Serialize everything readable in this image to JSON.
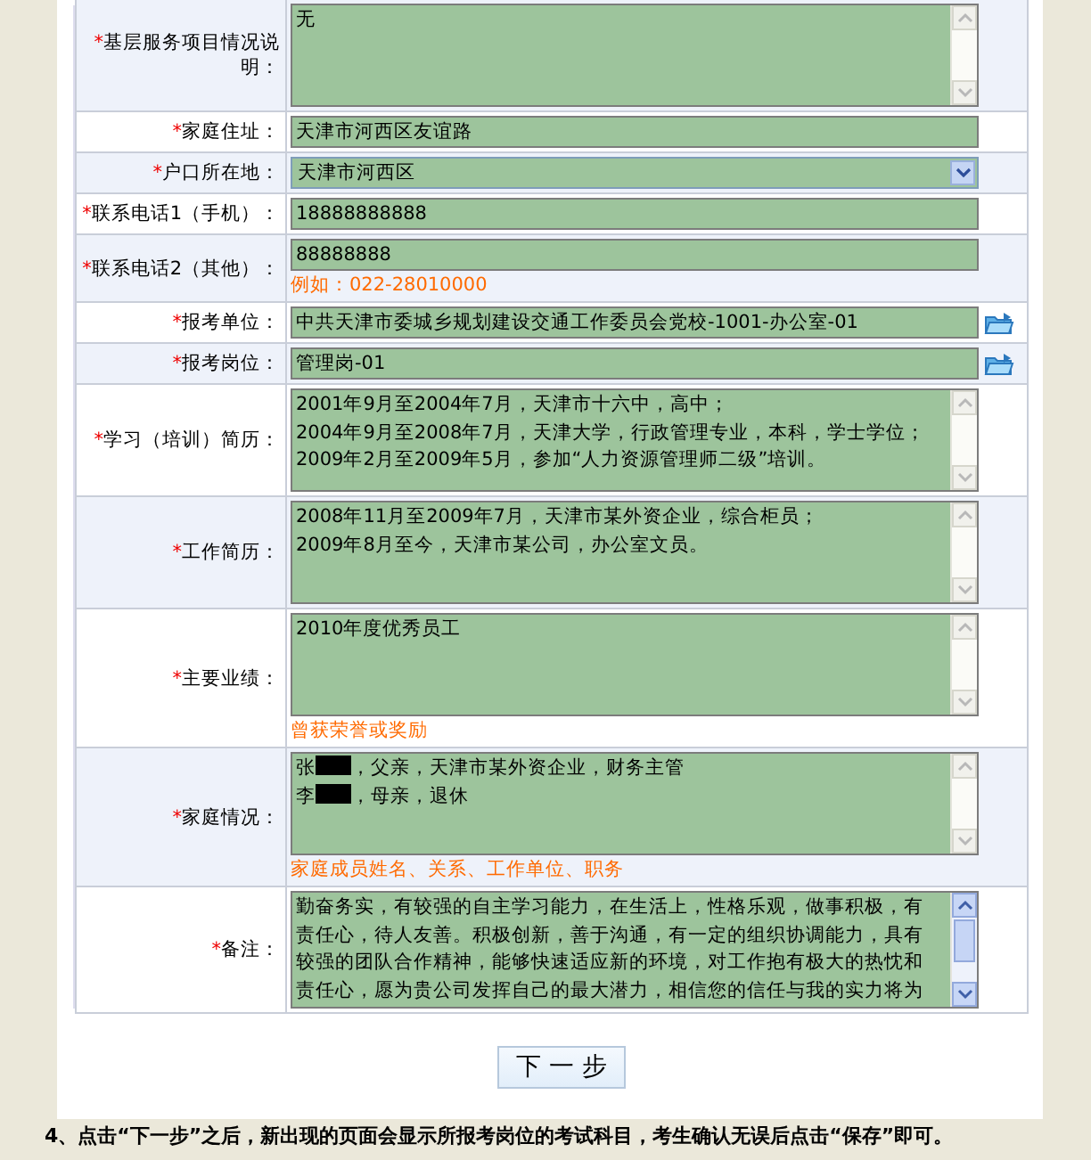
{
  "required_mark": "*",
  "rows": [
    {
      "kind": "textarea",
      "label": "基层服务项目情况说明：",
      "required": true,
      "lines": [
        "无"
      ],
      "scroll_enabled": false
    },
    {
      "kind": "input",
      "label": "家庭住址：",
      "required": true,
      "value": "天津市河西区友谊路"
    },
    {
      "kind": "select",
      "label": "户口所在地：",
      "required": true,
      "value": "天津市河西区"
    },
    {
      "kind": "input",
      "label": "联系电话1（手机）：",
      "required": true,
      "value": "18888888888"
    },
    {
      "kind": "input",
      "label": "联系电话2（其他）：",
      "required": true,
      "value": "88888888",
      "hint": "例如：022-28010000"
    },
    {
      "kind": "input",
      "label": "报考单位：",
      "required": true,
      "value": "中共天津市委城乡规划建设交通工作委员会党校-1001-办公室-01",
      "picker": true
    },
    {
      "kind": "input",
      "label": "报考岗位：",
      "required": true,
      "value": "管理岗-01",
      "picker": true
    },
    {
      "kind": "textarea",
      "label": "学习（培训）简历：",
      "required": true,
      "lines": [
        "2001年9月至2004年7月，天津市十六中，高中；",
        "2004年9月至2008年7月，天津大学，行政管理专业，本科，学士学位；",
        "2009年2月至2009年5月，参加“人力资源管理师二级”培训。"
      ],
      "scroll_enabled": false
    },
    {
      "kind": "textarea",
      "label": "工作简历：",
      "required": true,
      "lines": [
        "2008年11月至2009年7月，天津市某外资企业，综合柜员；",
        "2009年8月至今，天津市某公司，办公室文员。"
      ],
      "scroll_enabled": false
    },
    {
      "kind": "textarea",
      "label": "主要业绩：",
      "required": true,
      "lines": [
        "2010年度优秀员工"
      ],
      "scroll_enabled": false,
      "hint": "曾获荣誉或奖励"
    },
    {
      "kind": "textarea",
      "label": "家庭情况：",
      "required": true,
      "lines": [
        {
          "before": "张",
          "redacted": true,
          "after": "，父亲，天津市某外资企业，财务主管"
        },
        {
          "before": "李",
          "redacted": true,
          "after": "，母亲，退休"
        }
      ],
      "scroll_enabled": false,
      "hint": "家庭成员姓名、关系、工作单位、职务"
    },
    {
      "kind": "textarea",
      "label": "备注：",
      "required": true,
      "lines": [
        "勤奋务实，有较强的自主学习能力，在生活上，性格乐观，做事积极，有",
        "责任心，待人友善。积极创新，善于沟通，有一定的组织协调能力，具有",
        "较强的团队合作精神，能够快速适应新的环境，对工作抱有极大的热忱和",
        "责任心，愿为贵公司发挥自己的最大潜力，相信您的信任与我的实力将为"
      ],
      "scroll_enabled": true
    }
  ],
  "next_button": "下 一 步",
  "caption": "4、点击“下一步”之后，新出现的页面会显示所报考岗位的考试科目，考生确认无误后点击“保存”即可。"
}
